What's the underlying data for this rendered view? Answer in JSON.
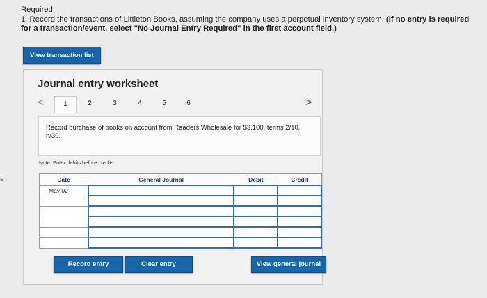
{
  "edge_fragment": "s",
  "required": {
    "heading": "Required:",
    "text_plain": "1. Record the transactions of Littleton Books, assuming the company uses a perpetual inventory system. ",
    "text_bold": "(If no entry is required for a transaction/event, select \"No Journal Entry Required\" in the first account field.)"
  },
  "view_transaction_list_label": "View transaction list",
  "worksheet": {
    "title": "Journal entry worksheet",
    "tabs": [
      "1",
      "2",
      "3",
      "4",
      "5",
      "6"
    ],
    "active_tab": "1",
    "prev_arrow": "<",
    "next_arrow": ">",
    "description": "Record purchase of books on account from Readers Wholesale for $3,100, terms 2/10, n/30.",
    "note": "Note: Enter debits before credits.",
    "table": {
      "headers": [
        "Date",
        "General Journal",
        "Debit",
        "Credit"
      ],
      "rows": [
        {
          "date": "May 02",
          "account": "",
          "debit": "",
          "credit": ""
        },
        {
          "date": "",
          "account": "",
          "debit": "",
          "credit": ""
        },
        {
          "date": "",
          "account": "",
          "debit": "",
          "credit": ""
        },
        {
          "date": "",
          "account": "",
          "debit": "",
          "credit": ""
        },
        {
          "date": "",
          "account": "",
          "debit": "",
          "credit": ""
        },
        {
          "date": "",
          "account": "",
          "debit": "",
          "credit": ""
        }
      ]
    },
    "buttons": {
      "record": "Record entry",
      "clear": "Clear entry",
      "view_journal": "View general journal"
    }
  },
  "colors": {
    "button_blue": "#1565a8",
    "header_text": "#1f3a5f",
    "input_border": "#2f6fb1"
  }
}
